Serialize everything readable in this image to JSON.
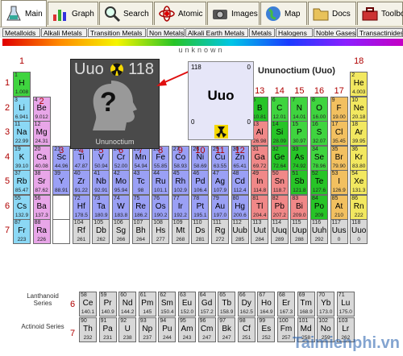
{
  "tabs": [
    {
      "label": "Main",
      "icon": "flask-icon",
      "active": true
    },
    {
      "label": "Graph",
      "icon": "chart-icon",
      "active": false
    },
    {
      "label": "Search",
      "icon": "search-icon",
      "active": false
    },
    {
      "label": "Atomic",
      "icon": "atom-icon",
      "active": false
    },
    {
      "label": "Images",
      "icon": "camera-icon",
      "active": false
    },
    {
      "label": "Map",
      "icon": "globe-icon",
      "active": false
    },
    {
      "label": "Docs",
      "icon": "folder-icon",
      "active": false
    },
    {
      "label": "Toolbox",
      "icon": "toolbox-icon",
      "active": false
    }
  ],
  "legend": [
    {
      "label": "Metalloids",
      "color": "#27c427"
    },
    {
      "label": "Alkali Metals",
      "color": "#8bd8f5"
    },
    {
      "label": "Transition Metals",
      "color": "#9aa0f5"
    },
    {
      "label": "Non Metals",
      "color": "#3fd43f"
    },
    {
      "label": "Alkali Earth Metals",
      "color": "#e8a6e8"
    },
    {
      "label": "Metals",
      "color": "#f08888"
    },
    {
      "label": "Halogens",
      "color": "#f2c060"
    },
    {
      "label": "Noble Gases",
      "color": "#f2e860"
    },
    {
      "label": "Transactinides",
      "color": "#d8d8d8"
    }
  ],
  "spectrum_label": "unknown",
  "groups": [
    "1",
    "2",
    "3",
    "4",
    "5",
    "6",
    "7",
    "8",
    "9",
    "10",
    "11",
    "12",
    "13",
    "14",
    "15",
    "16",
    "17",
    "18"
  ],
  "periods": [
    "1",
    "2",
    "3",
    "4",
    "5",
    "6",
    "7"
  ],
  "selected": {
    "tile_symbol": "Uuo",
    "tile_number": "118",
    "tile_name": "Ununoctium",
    "tile_glyph": "?",
    "detail_number": "118",
    "detail_mass": "0",
    "detail_symbol": "Uuo",
    "heading": "Ununoctium (Uuo)"
  },
  "series_labels": {
    "lanthanoid": "Lanthanoid Series",
    "lanthanoid_period": "6",
    "actinoid": "Actinoid Series",
    "actinoid_period": "7"
  },
  "watermark": "Taimienphi.vn",
  "elements": [
    {
      "n": "1",
      "s": "H",
      "m": "1.008",
      "g": 1,
      "p": 1,
      "t": "nonmetal"
    },
    {
      "n": "2",
      "s": "He",
      "m": "4.003",
      "g": 18,
      "p": 1,
      "t": "noble"
    },
    {
      "n": "3",
      "s": "Li",
      "m": "6.941",
      "g": 1,
      "p": 2,
      "t": "alkali"
    },
    {
      "n": "4",
      "s": "Be",
      "m": "9.012",
      "g": 2,
      "p": 2,
      "t": "earth"
    },
    {
      "n": "5",
      "s": "B",
      "m": "10.81",
      "g": 13,
      "p": 2,
      "t": "metalloid"
    },
    {
      "n": "6",
      "s": "C",
      "m": "12.01",
      "g": 14,
      "p": 2,
      "t": "nonmetal"
    },
    {
      "n": "7",
      "s": "N",
      "m": "14.01",
      "g": 15,
      "p": 2,
      "t": "nonmetal"
    },
    {
      "n": "8",
      "s": "O",
      "m": "16.00",
      "g": 16,
      "p": 2,
      "t": "nonmetal"
    },
    {
      "n": "9",
      "s": "F",
      "m": "19.00",
      "g": 17,
      "p": 2,
      "t": "halogen"
    },
    {
      "n": "10",
      "s": "Ne",
      "m": "20.18",
      "g": 18,
      "p": 2,
      "t": "noble"
    },
    {
      "n": "11",
      "s": "Na",
      "m": "22.99",
      "g": 1,
      "p": 3,
      "t": "alkali"
    },
    {
      "n": "12",
      "s": "Mg",
      "m": "24.31",
      "g": 2,
      "p": 3,
      "t": "earth"
    },
    {
      "n": "13",
      "s": "Al",
      "m": "26.98",
      "g": 13,
      "p": 3,
      "t": "metal"
    },
    {
      "n": "14",
      "s": "Si",
      "m": "28.09",
      "g": 14,
      "p": 3,
      "t": "metalloid"
    },
    {
      "n": "15",
      "s": "P",
      "m": "30.97",
      "g": 15,
      "p": 3,
      "t": "nonmetal"
    },
    {
      "n": "16",
      "s": "S",
      "m": "32.07",
      "g": 16,
      "p": 3,
      "t": "nonmetal"
    },
    {
      "n": "17",
      "s": "Cl",
      "m": "35.45",
      "g": 17,
      "p": 3,
      "t": "halogen"
    },
    {
      "n": "18",
      "s": "Ar",
      "m": "39.95",
      "g": 18,
      "p": 3,
      "t": "noble"
    },
    {
      "n": "19",
      "s": "K",
      "m": "39.10",
      "g": 1,
      "p": 4,
      "t": "alkali"
    },
    {
      "n": "20",
      "s": "Ca",
      "m": "40.08",
      "g": 2,
      "p": 4,
      "t": "earth"
    },
    {
      "n": "21",
      "s": "Sc",
      "m": "44.96",
      "g": 3,
      "p": 4,
      "t": "transition"
    },
    {
      "n": "22",
      "s": "Ti",
      "m": "47.87",
      "g": 4,
      "p": 4,
      "t": "transition"
    },
    {
      "n": "23",
      "s": "V",
      "m": "50.94",
      "g": 5,
      "p": 4,
      "t": "transition"
    },
    {
      "n": "24",
      "s": "Cr",
      "m": "52.00",
      "g": 6,
      "p": 4,
      "t": "transition"
    },
    {
      "n": "25",
      "s": "Mn",
      "m": "54.94",
      "g": 7,
      "p": 4,
      "t": "transition"
    },
    {
      "n": "26",
      "s": "Fe",
      "m": "55.85",
      "g": 8,
      "p": 4,
      "t": "transition"
    },
    {
      "n": "27",
      "s": "Co",
      "m": "58.93",
      "g": 9,
      "p": 4,
      "t": "transition"
    },
    {
      "n": "28",
      "s": "Ni",
      "m": "58.69",
      "g": 10,
      "p": 4,
      "t": "transition"
    },
    {
      "n": "29",
      "s": "Cu",
      "m": "63.55",
      "g": 11,
      "p": 4,
      "t": "transition"
    },
    {
      "n": "30",
      "s": "Zn",
      "m": "65.41",
      "g": 12,
      "p": 4,
      "t": "transition"
    },
    {
      "n": "31",
      "s": "Ga",
      "m": "69.72",
      "g": 13,
      "p": 4,
      "t": "metal"
    },
    {
      "n": "32",
      "s": "Ge",
      "m": "72.64",
      "g": 14,
      "p": 4,
      "t": "metalloid"
    },
    {
      "n": "33",
      "s": "As",
      "m": "74.92",
      "g": 15,
      "p": 4,
      "t": "metalloid"
    },
    {
      "n": "34",
      "s": "Se",
      "m": "78.96",
      "g": 16,
      "p": 4,
      "t": "nonmetal"
    },
    {
      "n": "35",
      "s": "Br",
      "m": "79.90",
      "g": 17,
      "p": 4,
      "t": "halogen"
    },
    {
      "n": "36",
      "s": "Kr",
      "m": "83.80",
      "g": 18,
      "p": 4,
      "t": "noble"
    },
    {
      "n": "37",
      "s": "Rb",
      "m": "85.47",
      "g": 1,
      "p": 5,
      "t": "alkali"
    },
    {
      "n": "38",
      "s": "Sr",
      "m": "87.62",
      "g": 2,
      "p": 5,
      "t": "earth"
    },
    {
      "n": "39",
      "s": "Y",
      "m": "88.91",
      "g": 3,
      "p": 5,
      "t": "transition"
    },
    {
      "n": "40",
      "s": "Zr",
      "m": "91.22",
      "g": 4,
      "p": 5,
      "t": "transition"
    },
    {
      "n": "41",
      "s": "Nb",
      "m": "92.91",
      "g": 5,
      "p": 5,
      "t": "transition"
    },
    {
      "n": "42",
      "s": "Mo",
      "m": "95.94",
      "g": 6,
      "p": 5,
      "t": "transition"
    },
    {
      "n": "43",
      "s": "Tc",
      "m": "98",
      "g": 7,
      "p": 5,
      "t": "transition"
    },
    {
      "n": "44",
      "s": "Ru",
      "m": "101.1",
      "g": 8,
      "p": 5,
      "t": "transition"
    },
    {
      "n": "45",
      "s": "Rh",
      "m": "102.9",
      "g": 9,
      "p": 5,
      "t": "transition"
    },
    {
      "n": "46",
      "s": "Pd",
      "m": "106.4",
      "g": 10,
      "p": 5,
      "t": "transition"
    },
    {
      "n": "47",
      "s": "Ag",
      "m": "107.9",
      "g": 11,
      "p": 5,
      "t": "transition"
    },
    {
      "n": "48",
      "s": "Cd",
      "m": "112.4",
      "g": 12,
      "p": 5,
      "t": "transition"
    },
    {
      "n": "49",
      "s": "In",
      "m": "114.8",
      "g": 13,
      "p": 5,
      "t": "metal"
    },
    {
      "n": "50",
      "s": "Sn",
      "m": "118.7",
      "g": 14,
      "p": 5,
      "t": "metal"
    },
    {
      "n": "51",
      "s": "Sb",
      "m": "121.8",
      "g": 15,
      "p": 5,
      "t": "metalloid"
    },
    {
      "n": "52",
      "s": "Te",
      "m": "127.6",
      "g": 16,
      "p": 5,
      "t": "metalloid"
    },
    {
      "n": "53",
      "s": "I",
      "m": "126.9",
      "g": 17,
      "p": 5,
      "t": "halogen"
    },
    {
      "n": "54",
      "s": "Xe",
      "m": "131.3",
      "g": 18,
      "p": 5,
      "t": "noble"
    },
    {
      "n": "55",
      "s": "Cs",
      "m": "132.9",
      "g": 1,
      "p": 6,
      "t": "alkali"
    },
    {
      "n": "56",
      "s": "Ba",
      "m": "137.3",
      "g": 2,
      "p": 6,
      "t": "earth"
    },
    {
      "n": "",
      "s": "",
      "m": "",
      "g": 3,
      "p": 6,
      "t": "gap"
    },
    {
      "n": "72",
      "s": "Hf",
      "m": "178.5",
      "g": 4,
      "p": 6,
      "t": "transition"
    },
    {
      "n": "73",
      "s": "Ta",
      "m": "180.9",
      "g": 5,
      "p": 6,
      "t": "transition"
    },
    {
      "n": "74",
      "s": "W",
      "m": "183.8",
      "g": 6,
      "p": 6,
      "t": "transition"
    },
    {
      "n": "75",
      "s": "Re",
      "m": "186.2",
      "g": 7,
      "p": 6,
      "t": "transition"
    },
    {
      "n": "76",
      "s": "Os",
      "m": "190.2",
      "g": 8,
      "p": 6,
      "t": "transition"
    },
    {
      "n": "77",
      "s": "Ir",
      "m": "192.2",
      "g": 9,
      "p": 6,
      "t": "transition"
    },
    {
      "n": "78",
      "s": "Pt",
      "m": "195.1",
      "g": 10,
      "p": 6,
      "t": "transition"
    },
    {
      "n": "79",
      "s": "Au",
      "m": "197.0",
      "g": 11,
      "p": 6,
      "t": "transition"
    },
    {
      "n": "80",
      "s": "Hg",
      "m": "200.6",
      "g": 12,
      "p": 6,
      "t": "transition"
    },
    {
      "n": "81",
      "s": "Tl",
      "m": "204.4",
      "g": 13,
      "p": 6,
      "t": "metal"
    },
    {
      "n": "82",
      "s": "Pb",
      "m": "207.2",
      "g": 14,
      "p": 6,
      "t": "metal"
    },
    {
      "n": "83",
      "s": "Bi",
      "m": "209.0",
      "g": 15,
      "p": 6,
      "t": "metal"
    },
    {
      "n": "84",
      "s": "Po",
      "m": "209",
      "g": 16,
      "p": 6,
      "t": "metalloid"
    },
    {
      "n": "85",
      "s": "At",
      "m": "210",
      "g": 17,
      "p": 6,
      "t": "halogen"
    },
    {
      "n": "86",
      "s": "Rn",
      "m": "222",
      "g": 18,
      "p": 6,
      "t": "noble"
    },
    {
      "n": "87",
      "s": "Fr",
      "m": "223",
      "g": 1,
      "p": 7,
      "t": "alkali"
    },
    {
      "n": "88",
      "s": "Ra",
      "m": "226",
      "g": 2,
      "p": 7,
      "t": "earth"
    },
    {
      "n": "",
      "s": "",
      "m": "",
      "g": 3,
      "p": 7,
      "t": "gap"
    },
    {
      "n": "104",
      "s": "Rf",
      "m": "261",
      "g": 4,
      "p": 7,
      "t": "trans"
    },
    {
      "n": "105",
      "s": "Db",
      "m": "262",
      "g": 5,
      "p": 7,
      "t": "trans"
    },
    {
      "n": "106",
      "s": "Sg",
      "m": "266",
      "g": 6,
      "p": 7,
      "t": "trans"
    },
    {
      "n": "107",
      "s": "Bh",
      "m": "264",
      "g": 7,
      "p": 7,
      "t": "trans"
    },
    {
      "n": "108",
      "s": "Hs",
      "m": "277",
      "g": 8,
      "p": 7,
      "t": "trans"
    },
    {
      "n": "109",
      "s": "Mt",
      "m": "268",
      "g": 9,
      "p": 7,
      "t": "trans"
    },
    {
      "n": "110",
      "s": "Ds",
      "m": "281",
      "g": 10,
      "p": 7,
      "t": "trans"
    },
    {
      "n": "111",
      "s": "Rg",
      "m": "272",
      "g": 11,
      "p": 7,
      "t": "trans"
    },
    {
      "n": "112",
      "s": "Uub",
      "m": "285",
      "g": 12,
      "p": 7,
      "t": "trans"
    },
    {
      "n": "113",
      "s": "Uut",
      "m": "284",
      "g": 13,
      "p": 7,
      "t": "trans"
    },
    {
      "n": "114",
      "s": "Uuq",
      "m": "289",
      "g": 14,
      "p": 7,
      "t": "trans"
    },
    {
      "n": "115",
      "s": "Uup",
      "m": "288",
      "g": 15,
      "p": 7,
      "t": "trans"
    },
    {
      "n": "116",
      "s": "Uuh",
      "m": "292",
      "g": 16,
      "p": 7,
      "t": "trans"
    },
    {
      "n": "117",
      "s": "Uus",
      "m": "0",
      "g": 17,
      "p": 7,
      "t": "trans"
    },
    {
      "n": "118",
      "s": "Uuo",
      "m": "0",
      "g": 18,
      "p": 7,
      "t": "trans"
    }
  ],
  "lanthanoids": [
    {
      "n": "58",
      "s": "Ce",
      "m": "140.1"
    },
    {
      "n": "59",
      "s": "Pr",
      "m": "140.9"
    },
    {
      "n": "60",
      "s": "Nd",
      "m": "144.2"
    },
    {
      "n": "61",
      "s": "Pm",
      "m": "145"
    },
    {
      "n": "62",
      "s": "Sm",
      "m": "150.4"
    },
    {
      "n": "63",
      "s": "Eu",
      "m": "152.0"
    },
    {
      "n": "64",
      "s": "Gd",
      "m": "157.2"
    },
    {
      "n": "65",
      "s": "Tb",
      "m": "158.9"
    },
    {
      "n": "66",
      "s": "Dy",
      "m": "162.5"
    },
    {
      "n": "67",
      "s": "Ho",
      "m": "164.9"
    },
    {
      "n": "68",
      "s": "Er",
      "m": "167.3"
    },
    {
      "n": "69",
      "s": "Tm",
      "m": "168.9"
    },
    {
      "n": "70",
      "s": "Yb",
      "m": "173.0"
    },
    {
      "n": "71",
      "s": "Lu",
      "m": "175.0"
    }
  ],
  "actinoids": [
    {
      "n": "90",
      "s": "Th",
      "m": "232"
    },
    {
      "n": "91",
      "s": "Pa",
      "m": "231"
    },
    {
      "n": "92",
      "s": "U",
      "m": "238"
    },
    {
      "n": "93",
      "s": "Np",
      "m": "237"
    },
    {
      "n": "94",
      "s": "Pu",
      "m": "244"
    },
    {
      "n": "95",
      "s": "Am",
      "m": "243"
    },
    {
      "n": "96",
      "s": "Cm",
      "m": "247"
    },
    {
      "n": "97",
      "s": "Bk",
      "m": "247"
    },
    {
      "n": "98",
      "s": "Cf",
      "m": "251"
    },
    {
      "n": "99",
      "s": "Es",
      "m": "252"
    },
    {
      "n": "100",
      "s": "Fm",
      "m": "257"
    },
    {
      "n": "101",
      "s": "Md",
      "m": "258"
    },
    {
      "n": "102",
      "s": "No",
      "m": "259"
    },
    {
      "n": "103",
      "s": "Lr",
      "m": "262"
    }
  ],
  "type_colors": {
    "nonmetal": "#3fd43f",
    "noble": "#f2e860",
    "alkali": "#8bd8f5",
    "earth": "#e8a6e8",
    "metalloid": "#27c427",
    "halogen": "#f2c060",
    "metal": "#f08888",
    "transition": "#9aa0f5",
    "trans": "#d8d8d8",
    "gap": "#ffffff",
    "series": "#d8d8d8"
  }
}
